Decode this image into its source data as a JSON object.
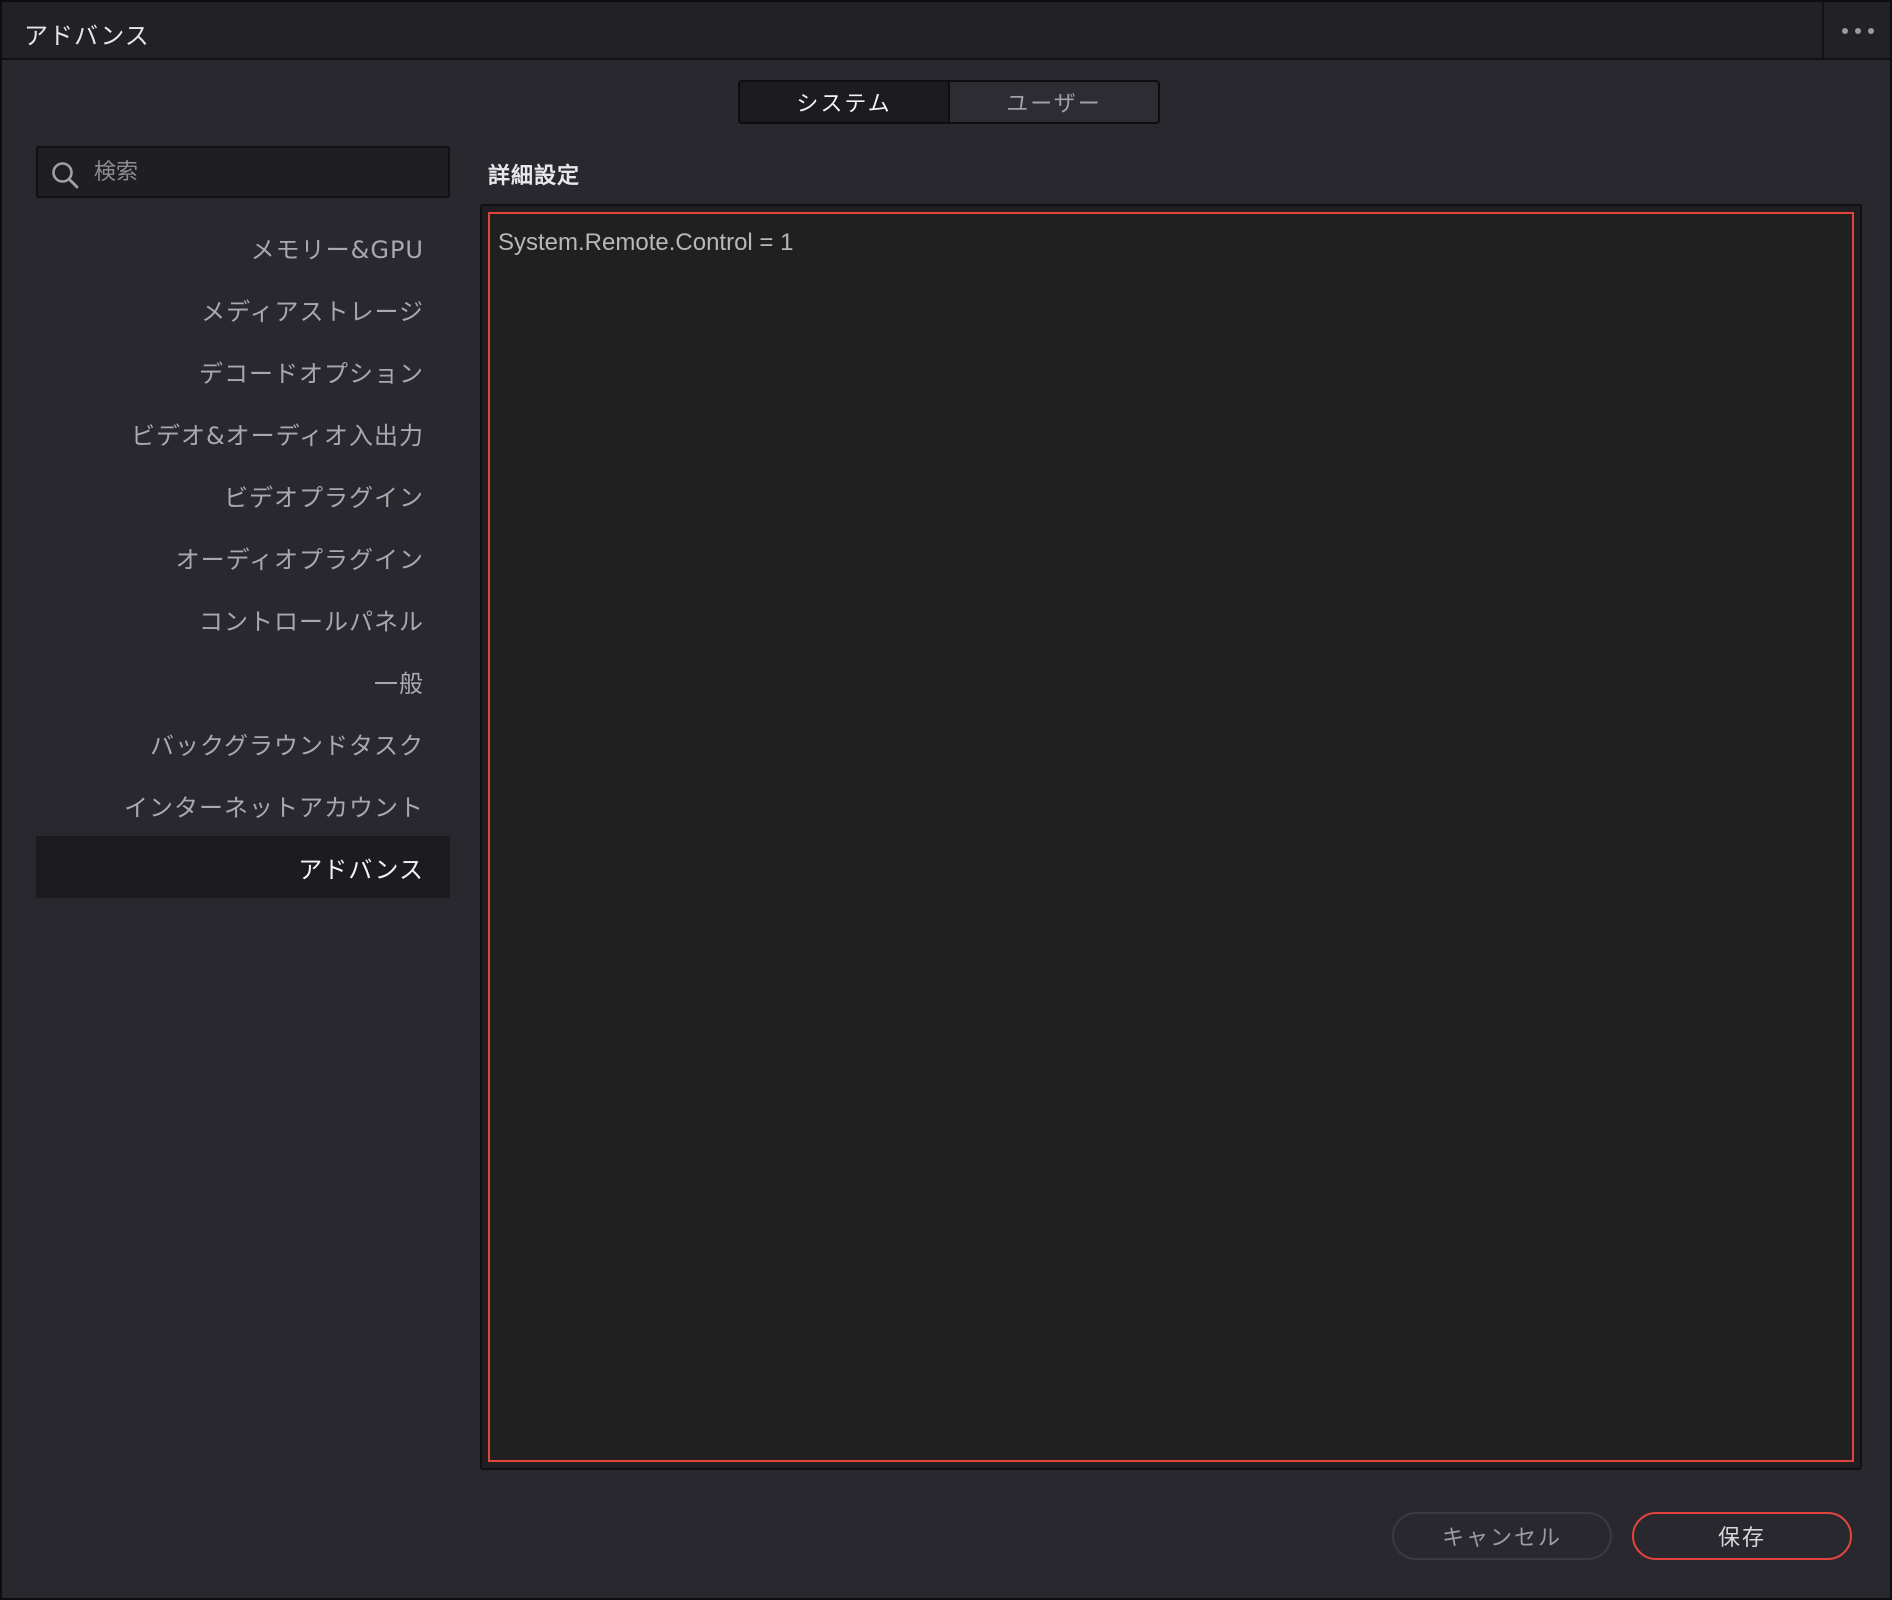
{
  "window": {
    "title": "アドバンス",
    "more_icon": "more-horizontal-icon"
  },
  "tabs": [
    {
      "label": "システム",
      "active": true
    },
    {
      "label": "ユーザー",
      "active": false
    }
  ],
  "search": {
    "placeholder": "検索",
    "value": "",
    "icon": "search-icon"
  },
  "sidebar": {
    "items": [
      {
        "label": "メモリー&GPU"
      },
      {
        "label": "メディアストレージ"
      },
      {
        "label": "デコードオプション"
      },
      {
        "label": "ビデオ&オーディオ入出力"
      },
      {
        "label": "ビデオプラグイン"
      },
      {
        "label": "オーディオプラグイン"
      },
      {
        "label": "コントロールパネル"
      },
      {
        "label": "一般"
      },
      {
        "label": "バックグラウンドタスク"
      },
      {
        "label": "インターネットアカウント"
      },
      {
        "label": "アドバンス",
        "active": true
      }
    ]
  },
  "main": {
    "section_title": "詳細設定",
    "editor_value": "System.Remote.Control = 1"
  },
  "buttons": {
    "cancel_label": "キャンセル",
    "save_label": "保存"
  },
  "colors": {
    "accent": "#e0443c",
    "background": "#28282e",
    "panel_dark": "#1c1c1e"
  }
}
